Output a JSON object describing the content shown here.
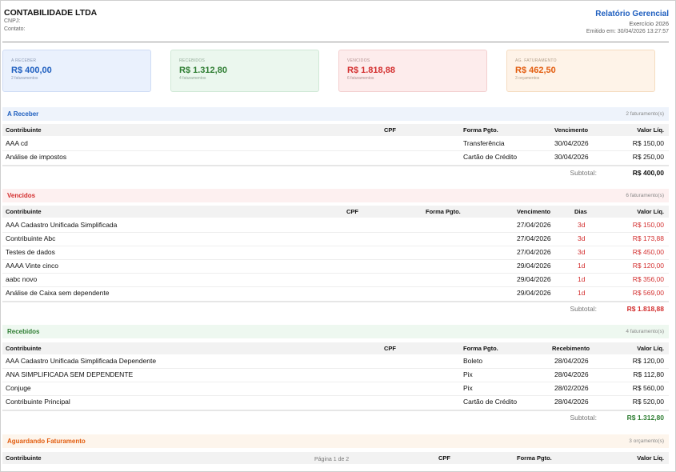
{
  "header": {
    "company": "CONTABILIDADE LTDA",
    "cnpj_label": "CNPJ:",
    "contato_label": "Contato:",
    "report_title": "Relatório Gerencial",
    "exercise": "Exercício 2026",
    "emitted": "Emitido em: 30/04/2026 13:27:57"
  },
  "cards": [
    {
      "label": "A RECEBER",
      "value": "R$ 400,00",
      "sub": "2 faturamentos",
      "color": "#1f5fbf"
    },
    {
      "label": "RECEBIDOS",
      "value": "R$ 1.312,80",
      "sub": "4 faturamentos",
      "color": "#2e7d32"
    },
    {
      "label": "VENCIDOS",
      "value": "R$ 1.818,88",
      "sub": "6 faturamentos",
      "color": "#d32f2f"
    },
    {
      "label": "AG. FATURAMENTO",
      "value": "R$ 462,50",
      "sub": "3 orçamentos",
      "color": "#e25c0e"
    }
  ],
  "areceber": {
    "title": "A Receber",
    "count": "2 faturamento(s)",
    "headers": {
      "contribuinte": "Contribuinte",
      "cpf": "CPF",
      "forma": "Forma Pgto.",
      "data": "Vencimento",
      "valor": "Valor Líq."
    },
    "rows": [
      {
        "contribuinte": "AAA cd",
        "cpf": "",
        "forma": "Transferência",
        "data": "30/04/2026",
        "valor": "R$ 150,00"
      },
      {
        "contribuinte": "Análise de impostos",
        "cpf": "",
        "forma": "Cartão de Crédito",
        "data": "30/04/2026",
        "valor": "R$ 250,00"
      }
    ],
    "subtotal_label": "Subtotal:",
    "subtotal": "R$ 400,00"
  },
  "vencidos": {
    "title": "Vencidos",
    "count": "6 faturamento(s)",
    "headers": {
      "contribuinte": "Contribuinte",
      "cpf": "CPF",
      "forma": "Forma Pgto.",
      "data": "Vencimento",
      "dias": "Dias",
      "valor": "Valor Líq."
    },
    "rows": [
      {
        "contribuinte": "AAA Cadastro Unificada Simplificada",
        "cpf": "",
        "forma": "",
        "data": "27/04/2026",
        "dias": "3d",
        "valor": "R$ 150,00"
      },
      {
        "contribuinte": "Contribuinte Abc",
        "cpf": "",
        "forma": "",
        "data": "27/04/2026",
        "dias": "3d",
        "valor": "R$ 173,88"
      },
      {
        "contribuinte": "Testes de dados",
        "cpf": "",
        "forma": "",
        "data": "27/04/2026",
        "dias": "3d",
        "valor": "R$ 450,00"
      },
      {
        "contribuinte": "AAAA Vinte cinco",
        "cpf": "",
        "forma": "",
        "data": "29/04/2026",
        "dias": "1d",
        "valor": "R$ 120,00"
      },
      {
        "contribuinte": "aabc novo",
        "cpf": "",
        "forma": "",
        "data": "29/04/2026",
        "dias": "1d",
        "valor": "R$ 356,00"
      },
      {
        "contribuinte": "Análise de Caixa sem dependente",
        "cpf": "",
        "forma": "",
        "data": "29/04/2026",
        "dias": "1d",
        "valor": "R$ 569,00"
      }
    ],
    "subtotal_label": "Subtotal:",
    "subtotal": "R$ 1.818,88"
  },
  "recebidos": {
    "title": "Recebidos",
    "count": "4 faturamento(s)",
    "headers": {
      "contribuinte": "Contribuinte",
      "cpf": "CPF",
      "forma": "Forma Pgto.",
      "data": "Recebimento",
      "valor": "Valor Líq."
    },
    "rows": [
      {
        "contribuinte": "AAA Cadastro Unificada Simplificada Dependente",
        "cpf": "",
        "forma": "Boleto",
        "data": "28/04/2026",
        "valor": "R$ 120,00"
      },
      {
        "contribuinte": "ANA SIMPLIFICADA SEM DEPENDENTE",
        "cpf": "",
        "forma": "Pix",
        "data": "28/04/2026",
        "valor": "R$ 112,80"
      },
      {
        "contribuinte": "Conjuge",
        "cpf": "",
        "forma": "Pix",
        "data": "28/02/2026",
        "valor": "R$ 560,00"
      },
      {
        "contribuinte": "Contribuinte Principal",
        "cpf": "",
        "forma": "Cartão de Crédito",
        "data": "28/04/2026",
        "valor": "R$ 520,00"
      }
    ],
    "subtotal_label": "Subtotal:",
    "subtotal": "R$ 1.312,80"
  },
  "aguardando": {
    "title": "Aguardando Faturamento",
    "count": "3 orçamento(s)",
    "headers": {
      "contribuinte": "Contribuinte",
      "cpf": "CPF",
      "forma": "Forma Pgto.",
      "valor": "Valor Líq."
    }
  },
  "footer": {
    "page": "Página 1 de 2"
  }
}
